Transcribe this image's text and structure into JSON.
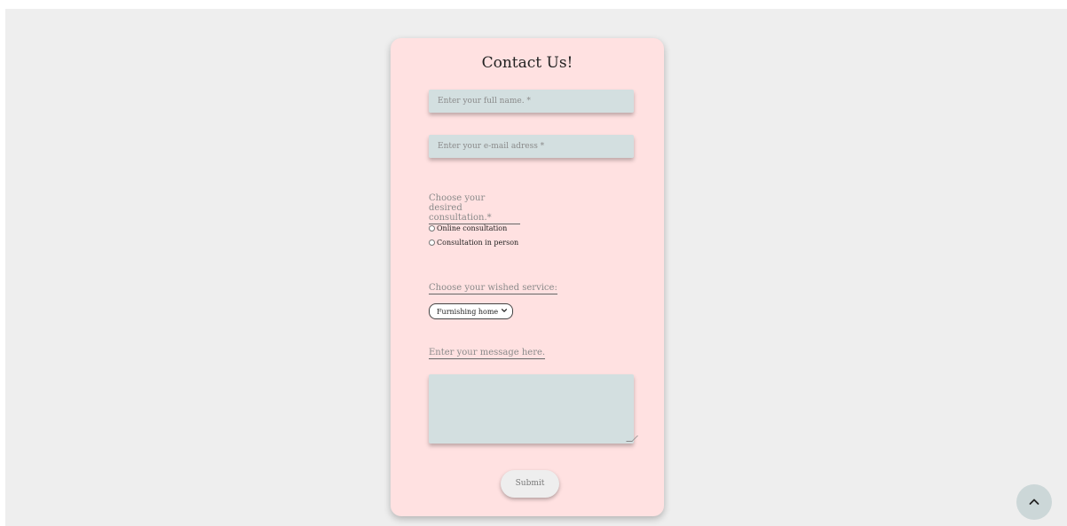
{
  "form": {
    "title": "Contact Us!",
    "name_placeholder": "Enter your full name. *",
    "email_placeholder": "Enter your e-mail adress *",
    "consultation_label": "Choose your desired consultation.*",
    "consultation_options": [
      "Online consultation",
      "Consultation in person"
    ],
    "service_label": "Choose your wished service:",
    "service_selected": "Furnishing home",
    "message_label": "Enter your message here.",
    "message_value": "",
    "submit_label": "Submit"
  },
  "icons": {
    "scroll_top": "chevron-up-icon",
    "select_arrow": "chevron-down-icon"
  },
  "colors": {
    "page_background": "#eeeeee",
    "card_background": "#ffe1e1",
    "field_background": "#d3dfe0",
    "scroll_button": "#ccd7d8"
  }
}
